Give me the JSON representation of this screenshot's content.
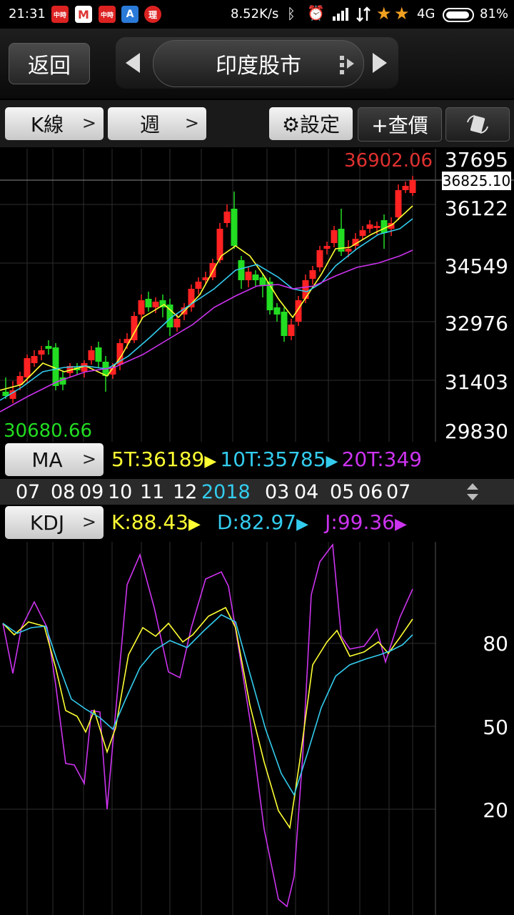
{
  "status": {
    "time": "21:31",
    "speed": "8.52K/s",
    "network": "4G",
    "battery": "81%",
    "app1": "中時",
    "app2": "M",
    "app3": "中時",
    "app4": "A",
    "app5": "理"
  },
  "header": {
    "back_label": "返回",
    "title": "印度股市"
  },
  "toolbar": {
    "kline_label": "K線",
    "period_label": "週",
    "settings_label": "⚙設定",
    "quote_label": "+查價",
    "chevron": ">"
  },
  "price_axis": {
    "labels": [
      "37695",
      "36122",
      "34549",
      "32976",
      "31403",
      "29830"
    ],
    "current_price": "36825.10",
    "high_label": "36902.06",
    "low_label": "30680.66"
  },
  "ma": {
    "button": "MA",
    "t5": "5T:36189",
    "t10": "10T:35785",
    "t20": "20T:349",
    "colors": {
      "ma5": "#ffff33",
      "ma10": "#33ccee",
      "ma20": "#cc33ee"
    }
  },
  "dates": {
    "labels": [
      "07",
      "08",
      "09",
      "10",
      "11",
      "12",
      "2018",
      "03",
      "04",
      "05",
      "06",
      "07"
    ]
  },
  "kdj": {
    "button": "KDJ",
    "k": "K:88.43",
    "d": "D:82.97",
    "j": "J:99.36",
    "axis_labels": [
      "80",
      "50",
      "20"
    ]
  },
  "colors": {
    "up": "#ff2222",
    "down": "#22dd22",
    "grid": "#2e2e2e"
  }
}
